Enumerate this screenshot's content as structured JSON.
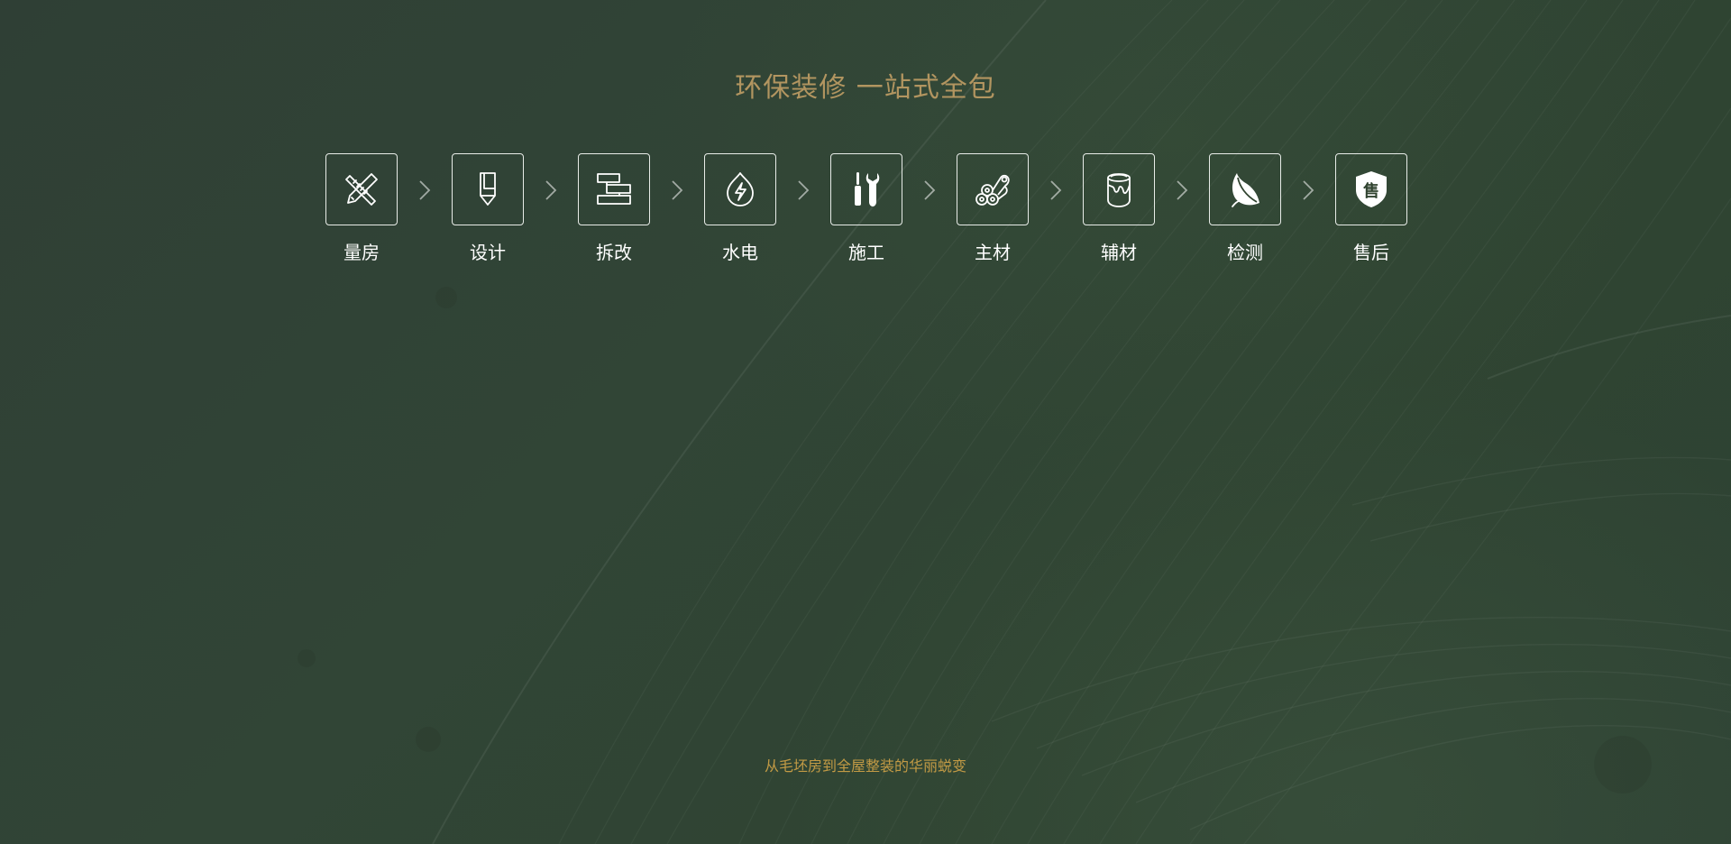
{
  "headline": "环保装修 一站式全包",
  "steps": [
    {
      "label": "量房",
      "icon": "ruler-pencil-icon"
    },
    {
      "label": "设计",
      "icon": "pen-nib-icon"
    },
    {
      "label": "拆改",
      "icon": "wall-bricks-icon"
    },
    {
      "label": "水电",
      "icon": "water-electric-icon"
    },
    {
      "label": "施工",
      "icon": "screwdriver-wrench-icon"
    },
    {
      "label": "主材",
      "icon": "material-rolls-icon"
    },
    {
      "label": "辅材",
      "icon": "paint-bucket-icon"
    },
    {
      "label": "检测",
      "icon": "leaf-icon"
    },
    {
      "label": "售后",
      "icon": "shield-badge-icon"
    }
  ],
  "shield_text": "售",
  "tagline": "从毛坯房到全屋整装的华丽蜕变",
  "colors": {
    "background": "#30432f",
    "headline": "#b29560",
    "tagline": "#c29a45",
    "icon_stroke": "#ffffff",
    "label": "#ffffff"
  }
}
